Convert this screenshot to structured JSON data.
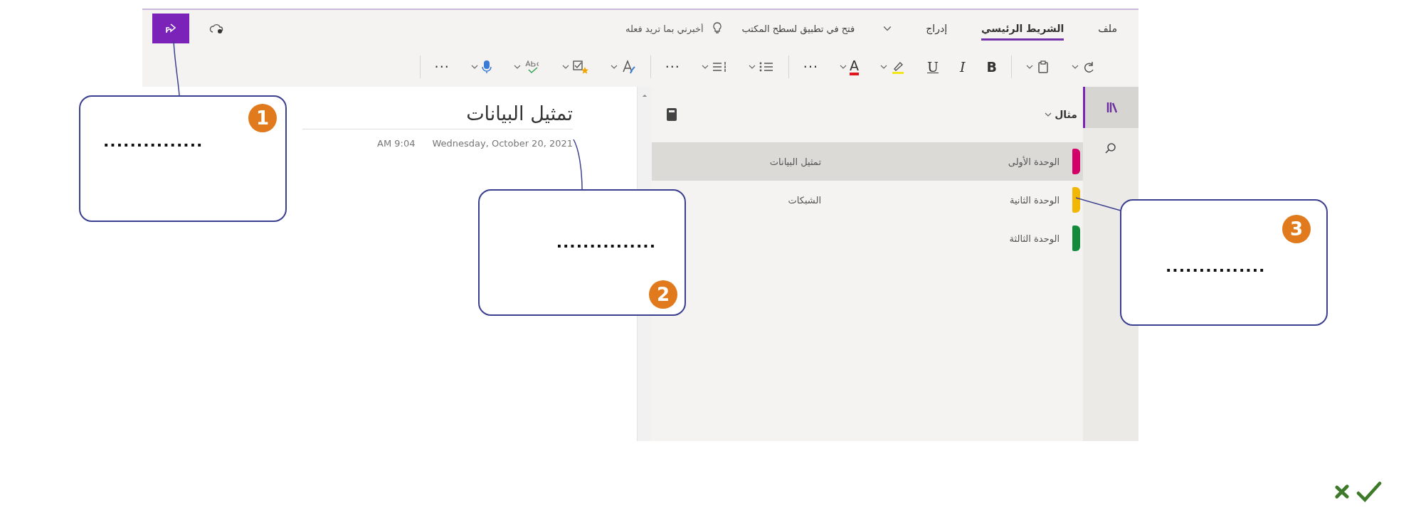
{
  "ribbon": {
    "tabs": [
      {
        "label": "ملف",
        "selected": false
      },
      {
        "label": "الشريط الرئيسي",
        "selected": true
      },
      {
        "label": "إدراج",
        "selected": false
      }
    ],
    "open_in_desktop": "فتح في تطبيق لسطح المكتب",
    "tell_me": {
      "placeholder": "أخبرني بما تريد فعله"
    }
  },
  "toolbar": [
    [
      {
        "kind": "redo",
        "dropdown": true
      },
      {
        "kind": "paste",
        "dropdown": true
      }
    ],
    [
      {
        "kind": "bold",
        "text": "B"
      },
      {
        "kind": "italic",
        "text": "I"
      },
      {
        "kind": "underline",
        "text": "U"
      },
      {
        "kind": "highlight",
        "dropdown": true
      },
      {
        "kind": "font_color",
        "text": "A",
        "dropdown": true
      },
      {
        "kind": "more",
        "text": "···"
      }
    ],
    [
      {
        "kind": "bullets",
        "dropdown": true
      },
      {
        "kind": "numbering",
        "dropdown": true
      },
      {
        "kind": "more",
        "text": "···"
      }
    ],
    [
      {
        "kind": "styles",
        "dropdown": true
      },
      {
        "kind": "tag",
        "dropdown": true
      },
      {
        "kind": "spelling",
        "dropdown": true
      },
      {
        "kind": "dictate",
        "dropdown": true
      },
      {
        "kind": "more",
        "text": "···"
      }
    ]
  ],
  "notebook": {
    "name": "مثال",
    "sections": [
      {
        "name": "الوحدة الأولى",
        "color": "#d4006a",
        "selected": true
      },
      {
        "name": "الوحدة الثانية",
        "color": "#f2b705",
        "selected": false
      },
      {
        "name": "الوحدة الثالثة",
        "color": "#138a3c",
        "selected": false
      }
    ],
    "pages": [
      {
        "title": "تمثيل البيانات",
        "selected": true
      },
      {
        "title": "الشبكات",
        "selected": false
      }
    ]
  },
  "page": {
    "title": "تمثيل البيانات",
    "date": "Wednesday, October 20, 2021",
    "time": "AM 9:04"
  },
  "callouts": [
    {
      "number": "1",
      "blank": "..............."
    },
    {
      "number": "2",
      "blank": "..............."
    },
    {
      "number": "3",
      "blank": "..............."
    }
  ]
}
